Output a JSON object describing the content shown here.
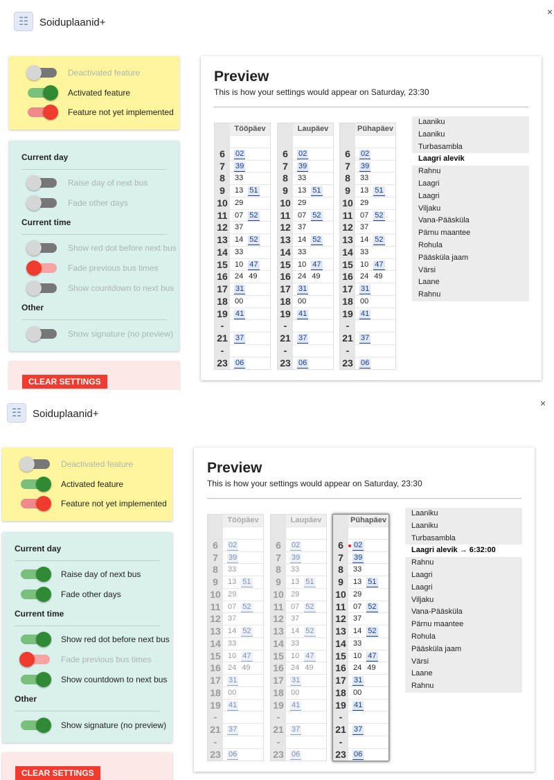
{
  "app": {
    "title": "Soiduplaanid+",
    "close": "×"
  },
  "legend": {
    "deactivated": "Deactivated feature",
    "activated": "Activated feature",
    "not_implemented": "Feature not yet implemented"
  },
  "settings": {
    "current_day": "Current day",
    "raise_day": "Raise day of next bus",
    "fade_other_days": "Fade other days",
    "current_time": "Current time",
    "red_dot": "Show red dot before next bus",
    "fade_previous": "Fade previous bus times",
    "countdown": "Show countdown to next bus",
    "other": "Other",
    "signature": "Show signature (no preview)"
  },
  "clear_button": "CLEAR SETTINGS",
  "preview": {
    "title": "Preview",
    "subtitle": "This is how your settings would appear on Saturday, 23:30"
  },
  "days": [
    "Tööpäev",
    "Laupäev",
    "Pühapäev"
  ],
  "schedule": [
    {
      "hour": "6",
      "mins": [
        {
          "t": "02",
          "link": true
        }
      ]
    },
    {
      "hour": "7",
      "mins": [
        {
          "t": "39",
          "link": true
        }
      ]
    },
    {
      "hour": "8",
      "mins": [
        {
          "t": "33",
          "link": false
        }
      ]
    },
    {
      "hour": "9",
      "mins": [
        {
          "t": "13",
          "link": false
        },
        {
          "t": "51",
          "link": true
        }
      ]
    },
    {
      "hour": "10",
      "mins": [
        {
          "t": "29",
          "link": false
        }
      ]
    },
    {
      "hour": "11",
      "mins": [
        {
          "t": "07",
          "link": false
        },
        {
          "t": "52",
          "link": true
        }
      ]
    },
    {
      "hour": "12",
      "mins": [
        {
          "t": "37",
          "link": false
        }
      ]
    },
    {
      "hour": "13",
      "mins": [
        {
          "t": "14",
          "link": false
        },
        {
          "t": "52",
          "link": true
        }
      ]
    },
    {
      "hour": "14",
      "mins": [
        {
          "t": "33",
          "link": false
        }
      ]
    },
    {
      "hour": "15",
      "mins": [
        {
          "t": "10",
          "link": false
        },
        {
          "t": "47",
          "link": true
        }
      ]
    },
    {
      "hour": "16",
      "mins": [
        {
          "t": "24",
          "link": false
        },
        {
          "t": "49",
          "link": false
        }
      ]
    },
    {
      "hour": "17",
      "mins": [
        {
          "t": "31",
          "link": true
        }
      ]
    },
    {
      "hour": "18",
      "mins": [
        {
          "t": "00",
          "link": false
        }
      ]
    },
    {
      "hour": "19",
      "mins": [
        {
          "t": "41",
          "link": true
        }
      ]
    },
    {
      "hour": "-",
      "mins": []
    },
    {
      "hour": "21",
      "mins": [
        {
          "t": "37",
          "link": true
        }
      ]
    },
    {
      "hour": "-",
      "mins": []
    },
    {
      "hour": "23",
      "mins": [
        {
          "t": "06",
          "link": true
        }
      ]
    }
  ],
  "stops": [
    "Laaniku",
    "Laaniku",
    "Turbasambla",
    "Laagri alevik",
    "Rahnu",
    "Laagri",
    "Laagri",
    "Viljaku",
    "Vana-Pääsküla",
    "Pärnu maantee",
    "Rohula",
    "Pääsküla jaam",
    "Värsi",
    "Laane",
    "Rahnu"
  ],
  "current_stop_index": 3,
  "countdown_suffix": " → 6:32:00",
  "states": [
    {
      "raise_day": "off",
      "fade_other_days": "off",
      "red_dot": "off",
      "fade_previous": "redoff",
      "countdown": "off",
      "signature": "off"
    },
    {
      "raise_day": "on",
      "fade_other_days": "on",
      "red_dot": "on",
      "fade_previous": "redoff",
      "countdown": "on",
      "signature": "on"
    }
  ]
}
